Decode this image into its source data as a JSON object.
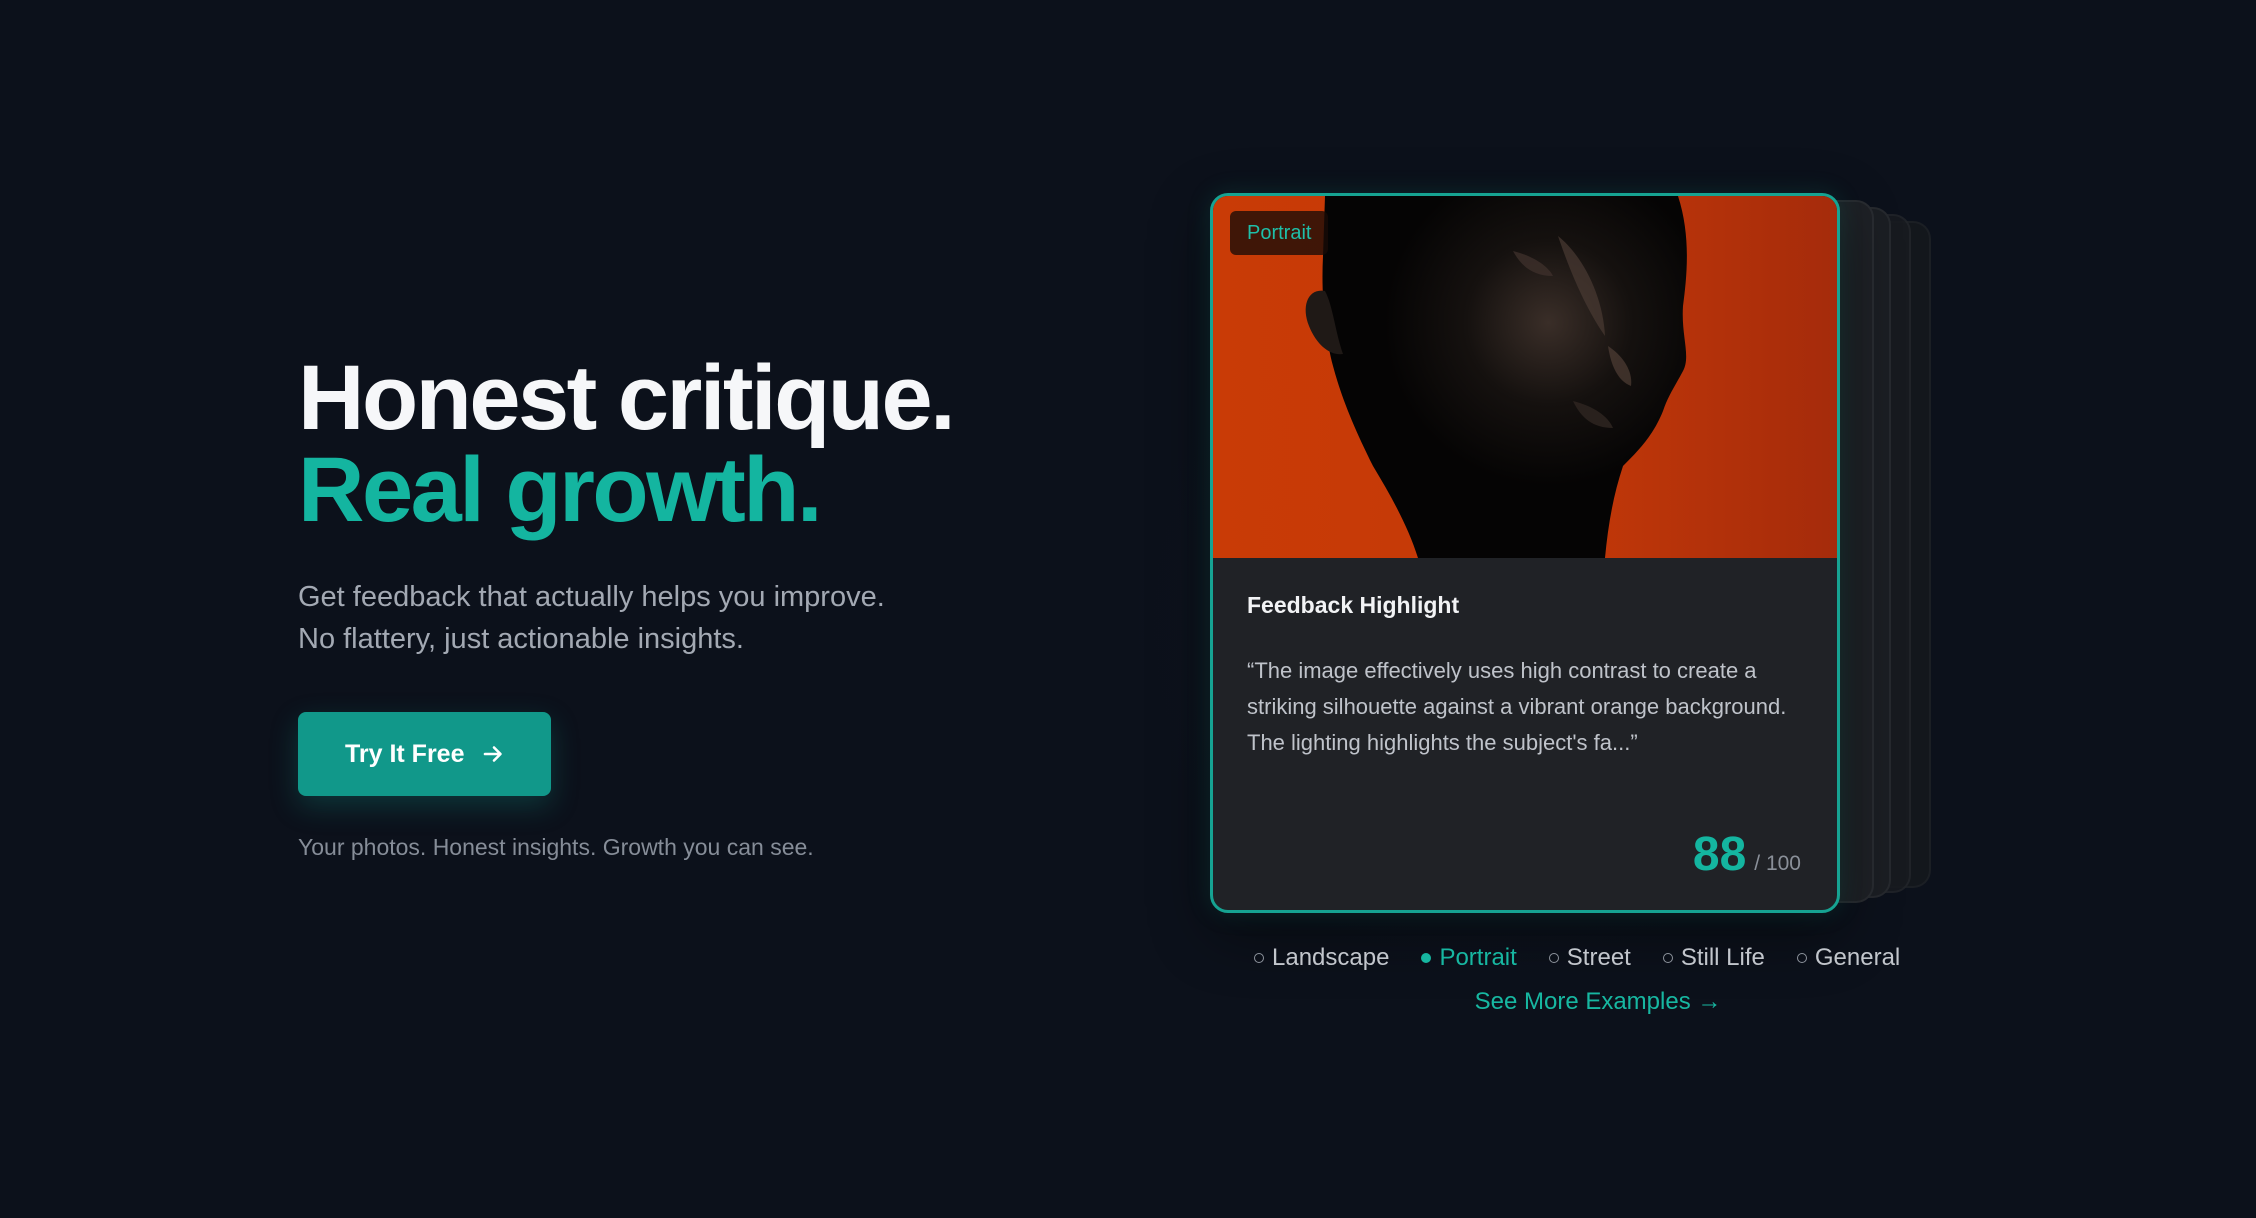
{
  "hero": {
    "headline_line1": "Honest critique.",
    "headline_line2": "Real growth.",
    "subtitle_line1": "Get feedback that actually helps you improve.",
    "subtitle_line2": "No flattery, just actionable insights.",
    "cta_label": "Try It Free",
    "cta_icon": "arrow-right-icon",
    "tagline": "Your photos. Honest insights. Growth you can see."
  },
  "card": {
    "badge": "Portrait",
    "title": "Feedback Highlight",
    "quote": "“The image effectively uses high contrast to create a striking silhouette against a vibrant orange background. The lighting highlights the subject's fa...”",
    "score": "88",
    "score_max": "/ 100"
  },
  "tabs": [
    {
      "label": "Landscape",
      "active": false
    },
    {
      "label": "Portrait",
      "active": true
    },
    {
      "label": "Street",
      "active": false
    },
    {
      "label": "Still Life",
      "active": false
    },
    {
      "label": "General",
      "active": false
    }
  ],
  "see_more": "See More Examples →",
  "colors": {
    "background": "#0c111b",
    "accent": "#14b5a0",
    "button": "#11988a",
    "card": "#202226",
    "photo_background": "#c93b06"
  }
}
